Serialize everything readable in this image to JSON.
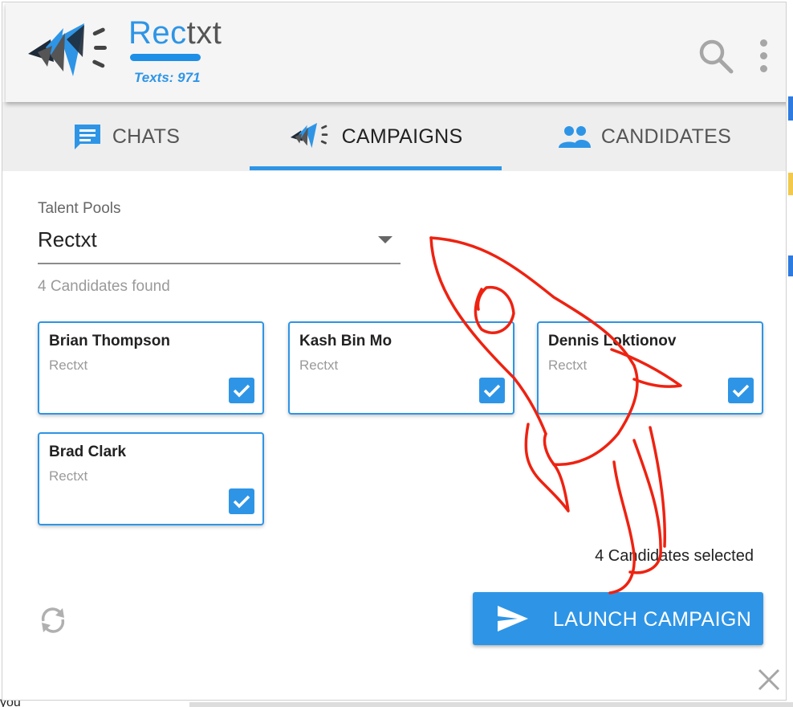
{
  "app": {
    "name_part1": "Rec",
    "name_part2": "txt",
    "texts_count": "Texts: 971",
    "colors": {
      "brand_blue": "#2e95e6",
      "header_bg": "#f5f5f5",
      "tab_bg": "#eeeeee",
      "doodle_red": "#ee2211"
    }
  },
  "header": {
    "search_icon": "search-icon",
    "menu_icon": "more-vertical-icon"
  },
  "tabs": [
    {
      "label": "CHATS",
      "icon": "chat-icon",
      "active": false
    },
    {
      "label": "CAMPAIGNS",
      "icon": "campaign-logo-icon",
      "active": true
    },
    {
      "label": "CANDIDATES",
      "icon": "people-icon",
      "active": false
    }
  ],
  "pool": {
    "label": "Talent Pools",
    "selected": "Rectxt",
    "found_text": "4 Candidates found"
  },
  "candidates": [
    {
      "name": "Brian Thompson",
      "pool": "Rectxt",
      "checked": true
    },
    {
      "name": "Kash Bin Mo",
      "pool": "Rectxt",
      "checked": true
    },
    {
      "name": "Dennis Loktionov",
      "pool": "Rectxt",
      "checked": true
    },
    {
      "name": "Brad Clark",
      "pool": "Rectxt",
      "checked": true
    }
  ],
  "footer": {
    "selected_text": "4 Candidates selected",
    "launch_label": "LAUNCH CAMPAIGN",
    "refresh_icon": "refresh-icon",
    "close_icon": "close-icon"
  },
  "background_page": {
    "snippet": "you"
  }
}
